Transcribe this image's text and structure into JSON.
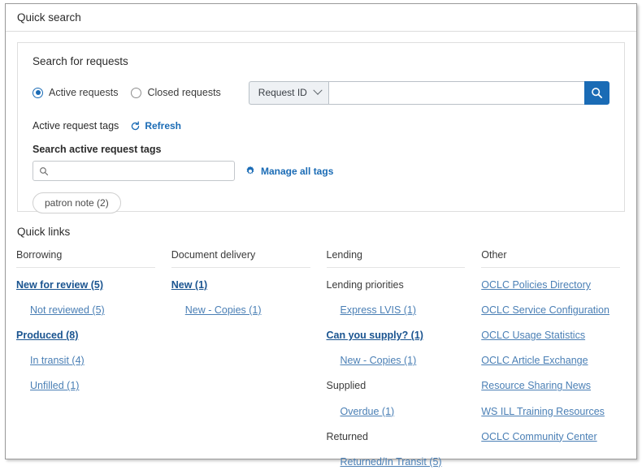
{
  "window": {
    "title": "Quick search"
  },
  "search_card": {
    "heading": "Search for requests",
    "radios": [
      {
        "label": "Active requests",
        "checked": true
      },
      {
        "label": "Closed requests",
        "checked": false
      }
    ],
    "scope_select": {
      "value": "Request ID",
      "icon": "chevron-down-icon"
    },
    "search_input": {
      "value": "",
      "placeholder": ""
    },
    "search_button_icon": "search-icon",
    "tags": {
      "title": "Active request tags",
      "refresh_label": "Refresh",
      "refresh_icon": "refresh-icon",
      "search_label": "Search active request tags",
      "search_input": {
        "value": "",
        "placeholder": ""
      },
      "search_icon": "search-icon",
      "manage_label": "Manage all tags",
      "manage_icon": "gear-icon",
      "chips": [
        "patron note (2)"
      ]
    }
  },
  "quick_links": {
    "title": "Quick links",
    "columns": [
      {
        "head": "Borrowing",
        "items": [
          {
            "label": "New for review (5)",
            "style": "link-primary",
            "indent": false
          },
          {
            "label": "Not reviewed (5)",
            "style": "link",
            "indent": true
          },
          {
            "label": "Produced (8)",
            "style": "link-primary",
            "indent": false
          },
          {
            "label": "In transit (4)",
            "style": "link",
            "indent": true
          },
          {
            "label": "Unfilled (1)",
            "style": "link",
            "indent": true
          }
        ]
      },
      {
        "head": "Document delivery",
        "items": [
          {
            "label": "New (1)",
            "style": "link-primary",
            "indent": false
          },
          {
            "label": "New - Copies (1)",
            "style": "link",
            "indent": true
          }
        ]
      },
      {
        "head": "Lending",
        "items": [
          {
            "label": "Lending priorities",
            "style": "text",
            "indent": false
          },
          {
            "label": "Express LVIS (1)",
            "style": "link",
            "indent": true
          },
          {
            "label": "Can you supply? (1)",
            "style": "link-primary",
            "indent": false
          },
          {
            "label": "New - Copies (1)",
            "style": "link",
            "indent": true
          },
          {
            "label": "Supplied",
            "style": "text",
            "indent": false
          },
          {
            "label": "Overdue (1)",
            "style": "link",
            "indent": true
          },
          {
            "label": "Returned",
            "style": "text",
            "indent": false
          },
          {
            "label": "Returned/In Transit (5)",
            "style": "link",
            "indent": true
          }
        ]
      },
      {
        "head": "Other",
        "items": [
          {
            "label": "OCLC Policies Directory",
            "style": "link",
            "indent": false
          },
          {
            "label": "OCLC Service Configuration",
            "style": "link",
            "indent": false
          },
          {
            "label": "OCLC Usage Statistics",
            "style": "link",
            "indent": false
          },
          {
            "label": "OCLC Article Exchange",
            "style": "link",
            "indent": false
          },
          {
            "label": "Resource Sharing News",
            "style": "link",
            "indent": false
          },
          {
            "label": "WS ILL Training Resources",
            "style": "link",
            "indent": false
          },
          {
            "label": "OCLC Community Center",
            "style": "link",
            "indent": false
          }
        ]
      }
    ]
  },
  "colors": {
    "accent_blue": "#1a6bb5",
    "link_blue": "#4a7fb5",
    "link_blue_bold": "#1a5490"
  }
}
